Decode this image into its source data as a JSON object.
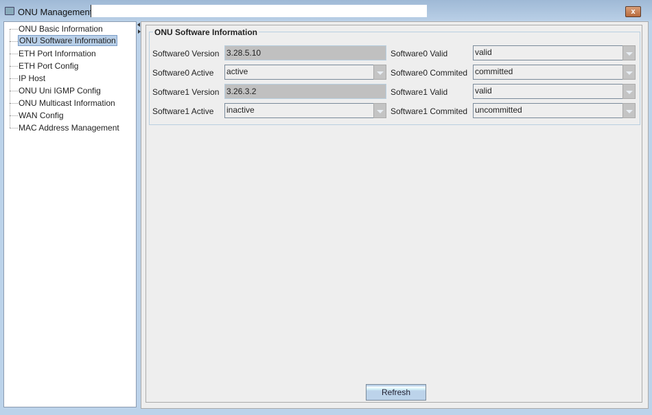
{
  "window": {
    "title": "ONU Management(",
    "close_label": "x"
  },
  "tree": {
    "items": [
      {
        "label": "ONU Basic Information"
      },
      {
        "label": "ONU Software Information",
        "selected": true
      },
      {
        "label": "ETH Port Information"
      },
      {
        "label": "ETH Port Config"
      },
      {
        "label": "IP Host"
      },
      {
        "label": "ONU Uni IGMP Config"
      },
      {
        "label": "ONU Multicast Information"
      },
      {
        "label": "WAN Config"
      },
      {
        "label": "MAC Address Management"
      }
    ]
  },
  "panel": {
    "legend": "ONU Software Information",
    "sw0_version_label": "Software0 Version",
    "sw0_version": "3.28.5.10",
    "sw0_active_label": "Software0 Active",
    "sw0_active": "active",
    "sw1_version_label": "Software1 Version",
    "sw1_version": "3.26.3.2",
    "sw1_active_label": "Software1 Active",
    "sw1_active": "inactive",
    "sw0_valid_label": "Software0 Valid",
    "sw0_valid": "valid",
    "sw0_commited_label": "Software0 Commited",
    "sw0_commited": "committed",
    "sw1_valid_label": "Software1 Valid",
    "sw1_valid": "valid",
    "sw1_commited_label": "Software1 Commited",
    "sw1_commited": "uncommitted",
    "refresh_label": "Refresh"
  }
}
